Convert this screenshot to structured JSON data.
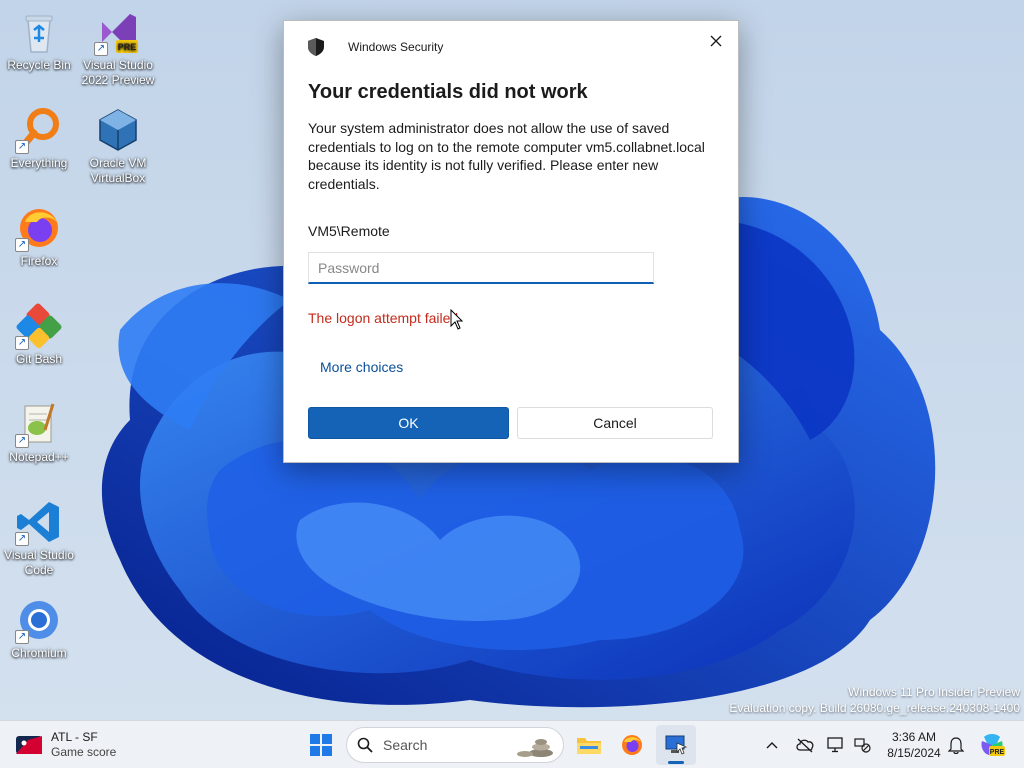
{
  "desktop": {
    "icons": [
      {
        "label": "Recycle Bin"
      },
      {
        "label": "Visual Studio 2022 Preview",
        "badge": "PRE"
      },
      {
        "label": "Everything"
      },
      {
        "label": "Oracle VM VirtualBox"
      },
      {
        "label": "Firefox"
      },
      {
        "label": "Git Bash"
      },
      {
        "label": "Notepad++"
      },
      {
        "label": "Visual Studio Code"
      },
      {
        "label": "Chromium"
      }
    ],
    "watermark": {
      "line1": "Windows 11 Pro Insider Preview",
      "line2": "Evaluation copy. Build 26080.ge_release.240308-1400"
    }
  },
  "dialog": {
    "app_title": "Windows Security",
    "heading": "Your credentials did not work",
    "message": "Your system administrator does not allow the use of saved credentials to log on to the remote computer vm5.collabnet.local because its identity is not fully verified. Please enter new credentials.",
    "username": "VM5\\Remote",
    "password_placeholder": "Password",
    "password_value": "",
    "error": "The logon attempt failed",
    "more_choices": "More choices",
    "ok_label": "OK",
    "cancel_label": "Cancel"
  },
  "taskbar": {
    "widget": {
      "title": "ATL - SF",
      "subtitle": "Game score"
    },
    "search_label": "Search",
    "tray_badge": "PRE",
    "clock": {
      "time": "3:36 AM",
      "date": "8/15/2024"
    }
  },
  "colors": {
    "accent": "#1463b6",
    "error": "#c42b1c",
    "link": "#0b4f9a"
  }
}
